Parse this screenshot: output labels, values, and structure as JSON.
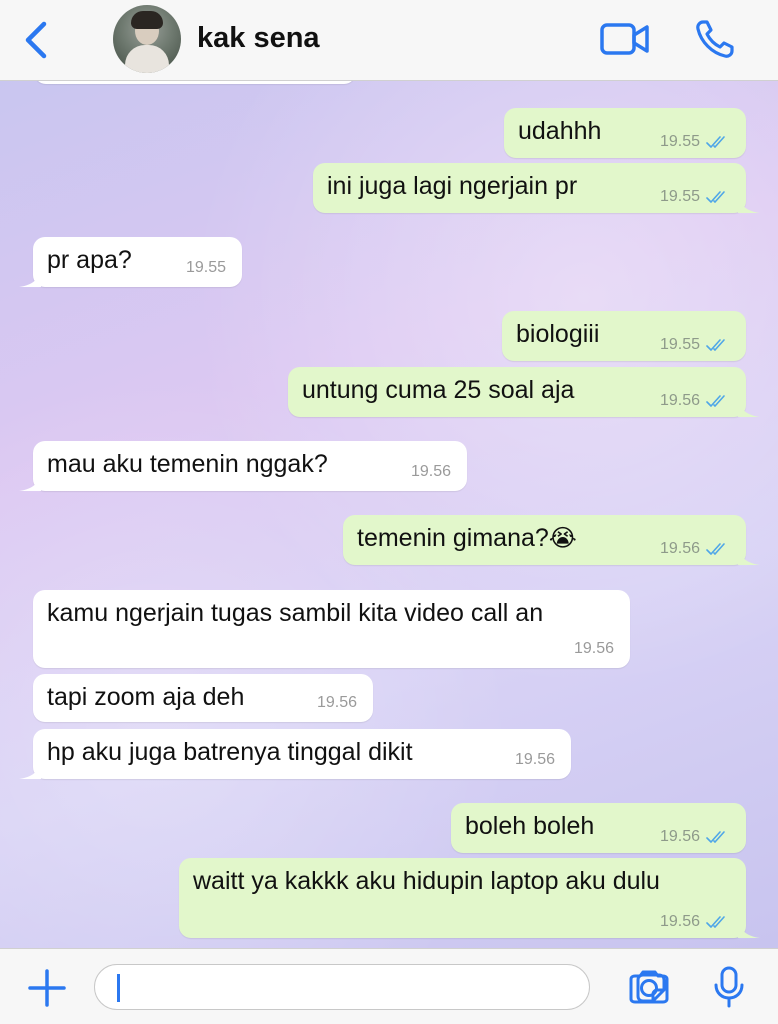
{
  "header": {
    "contact_name": "kak sena",
    "back_icon": "chevron-left-icon",
    "video_icon": "video-camera-icon",
    "call_icon": "phone-icon",
    "accent_color": "#2b78f0"
  },
  "messages": [
    {
      "direction": "outgoing",
      "text": "udahhh",
      "time": "19.55",
      "status_icon": "double-check-icon"
    },
    {
      "direction": "outgoing",
      "text": "ini juga lagi ngerjain pr",
      "time": "19.55",
      "status_icon": "double-check-icon"
    },
    {
      "direction": "incoming",
      "text": "pr apa?",
      "time": "19.55"
    },
    {
      "direction": "outgoing",
      "text": "biologiii",
      "time": "19.55",
      "status_icon": "double-check-icon"
    },
    {
      "direction": "outgoing",
      "text": "untung cuma 25 soal aja",
      "time": "19.56",
      "status_icon": "double-check-icon"
    },
    {
      "direction": "incoming",
      "text": "mau aku temenin nggak?",
      "time": "19.56"
    },
    {
      "direction": "outgoing",
      "text": "temenin gimana?",
      "emoji": "😭",
      "time": "19.56",
      "status_icon": "double-check-icon"
    },
    {
      "direction": "incoming",
      "text": "kamu ngerjain tugas sambil kita video call an",
      "time": "19.56"
    },
    {
      "direction": "incoming",
      "text": "tapi zoom aja deh",
      "time": "19.56"
    },
    {
      "direction": "incoming",
      "text": "hp aku juga batrenya tinggal dikit",
      "time": "19.56"
    },
    {
      "direction": "outgoing",
      "text": "boleh boleh",
      "time": "19.56",
      "status_icon": "double-check-icon"
    },
    {
      "direction": "outgoing",
      "text": "waitt ya kakkk aku hidupin laptop aku dulu",
      "time": "19.56",
      "status_icon": "double-check-icon"
    }
  ],
  "input_bar": {
    "placeholder": "",
    "plus_icon": "plus-icon",
    "sticker_icon": "sticker-icon",
    "camera_icon": "camera-icon",
    "mic_icon": "microphone-icon"
  },
  "colors": {
    "incoming_bubble": "#ffffff",
    "outgoing_bubble": "#e2f7cb",
    "read_ticks": "#4fa6e8"
  }
}
